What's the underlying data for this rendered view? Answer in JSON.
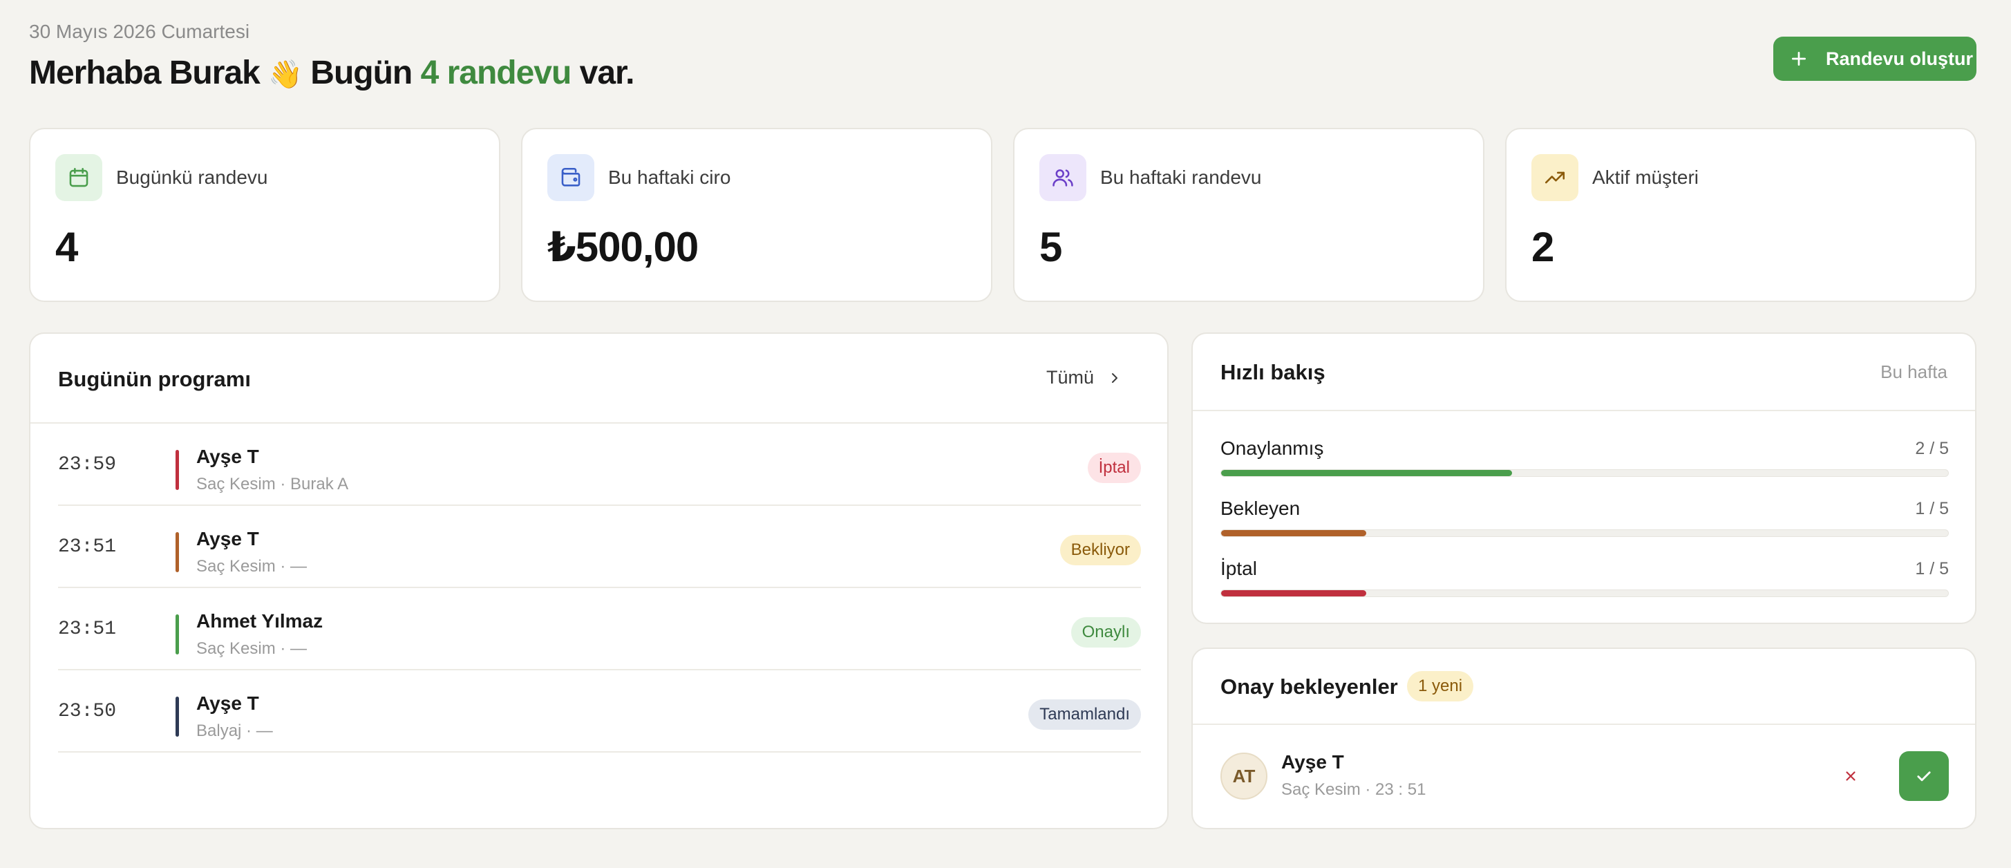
{
  "header": {
    "date": "30 Mayıs 2026 Cumartesi",
    "greeting_prefix": "Merhaba Burak",
    "wave": "👋",
    "greeting_mid": " Bugün ",
    "greeting_accent": "4 randevu",
    "greeting_suffix": " var.",
    "create_button_label": "Randevu oluştur",
    "accent_color": "#3f8a3f",
    "button_color": "#4a9e4c"
  },
  "stats": [
    {
      "icon": "calendar-icon",
      "label": "Bugünkü randevu",
      "value": "4"
    },
    {
      "icon": "wallet-icon",
      "label": "Bu haftaki ciro",
      "value": "₺500,00"
    },
    {
      "icon": "users-icon",
      "label": "Bu haftaki randevu",
      "value": "5"
    },
    {
      "icon": "trending-up-icon",
      "label": "Aktif müşteri",
      "value": "2"
    }
  ],
  "program": {
    "title": "Bugünün programı",
    "all_link": "Tümü",
    "rows": [
      {
        "time": "23:59",
        "name": "Ayşe T",
        "sub": "Saç Kesim · Burak A",
        "status": "İptal",
        "bar_color": "#c0303e",
        "badge_bg": "#fde3e6",
        "badge_fg": "#c0303e"
      },
      {
        "time": "23:51",
        "name": "Ayşe T",
        "sub": "Saç Kesim · —",
        "status": "Bekliyor",
        "bar_color": "#b0612a",
        "badge_bg": "#fbefc8",
        "badge_fg": "#8a5a0a"
      },
      {
        "time": "23:51",
        "name": "Ahmet Yılmaz",
        "sub": "Saç Kesim · —",
        "status": "Onaylı",
        "bar_color": "#4a9e4c",
        "badge_bg": "#e4f4e4",
        "badge_fg": "#3f8a3f"
      },
      {
        "time": "23:50",
        "name": "Ayşe T",
        "sub": "Balyaj · —",
        "status": "Tamamlandı",
        "bar_color": "#2e3a55",
        "badge_bg": "#e4e8ef",
        "badge_fg": "#2e3a55"
      }
    ]
  },
  "quick": {
    "title": "Hızlı bakış",
    "period": "Bu hafta",
    "items": [
      {
        "label": "Onaylanmış",
        "count": "2 / 5",
        "fraction": 0.4,
        "color": "#4a9e4c"
      },
      {
        "label": "Bekleyen",
        "count": "1 / 5",
        "fraction": 0.2,
        "color": "#b0612a"
      },
      {
        "label": "İptal",
        "count": "1 / 5",
        "fraction": 0.2,
        "color": "#c0303e"
      }
    ]
  },
  "pending": {
    "title": "Onay bekleyenler",
    "new_badge": "1 yeni",
    "item": {
      "initials": "AT",
      "name": "Ayşe T",
      "sub": "Saç Kesim · 23 : 51"
    }
  }
}
